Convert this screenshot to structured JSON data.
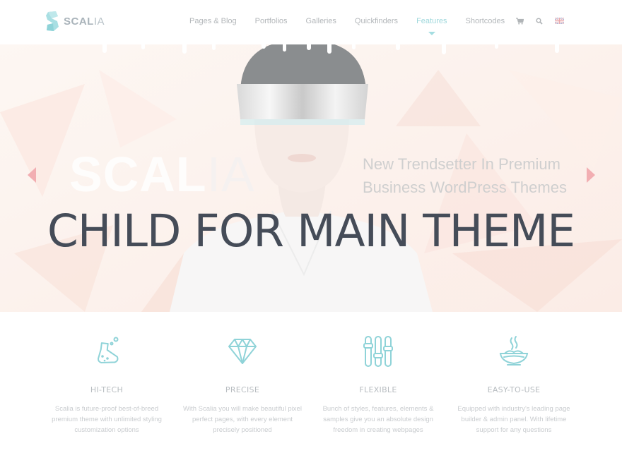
{
  "brand": {
    "part1": "SCAL",
    "part2": "IA"
  },
  "nav": {
    "items": [
      {
        "label": "Pages & Blog",
        "active": false
      },
      {
        "label": "Portfolios",
        "active": false
      },
      {
        "label": "Galleries",
        "active": false
      },
      {
        "label": "Quickfinders",
        "active": false
      },
      {
        "label": "Features",
        "active": true
      },
      {
        "label": "Shortcodes",
        "active": false
      }
    ],
    "icons": [
      "cart-icon",
      "search-icon",
      "uk-flag-icon"
    ]
  },
  "hero": {
    "word_part1": "SCAL",
    "word_part2": "IA",
    "tagline_line1": "New Trendsetter In Premium",
    "tagline_line2": "Business WordPress Themes",
    "headline": "CHILD FOR MAIN THEME",
    "prev_icon": "arrow-left-icon",
    "next_icon": "arrow-right-icon"
  },
  "features": [
    {
      "icon": "flask-icon",
      "title": "HI-TECH",
      "desc": "Scalia is future-proof best-of-breed premium theme with unlimited styling customization options"
    },
    {
      "icon": "diamond-icon",
      "title": "PRECISE",
      "desc": "With Scalia you will make beautiful pixel perfect pages, with every element precisely positioned"
    },
    {
      "icon": "sliders-icon",
      "title": "FLEXIBLE",
      "desc": "Bunch of styles, features, elements & samples give you an absolute design freedom in creating webpages"
    },
    {
      "icon": "noodle-bowl-icon",
      "title": "EASY-TO-USE",
      "desc": "Equipped with industry's leading page builder & admin panel. With lifetime support for any questions"
    }
  ],
  "colors": {
    "accent": "#a4dde1",
    "headline": "#454c58",
    "nav_text": "#b3b7ba",
    "arrow": "#f2aeb2"
  }
}
